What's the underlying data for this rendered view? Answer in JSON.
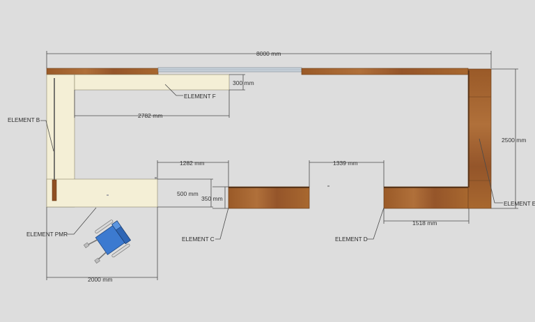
{
  "colors": {
    "background": "#dddddd",
    "wood": "#a4622e",
    "wood_dark": "#7f4a21",
    "cream": "#f4efd6",
    "glass": "#c9d3dc",
    "wheelchair": "#3c7ad0",
    "dimension_line": "#4a4a4a"
  },
  "dimensions": {
    "overall_width": "8000 mm",
    "depth_right": "2500 mm",
    "element_f_depth": "300 mm",
    "element_f_length": "2782 mm",
    "gap_left": "1282 mm",
    "gap_right": "1339 mm",
    "counter_depth": "500 mm",
    "element_c_depth": "350 mm",
    "element_d_length": "1518 mm",
    "pmr_length": "2000 mm"
  },
  "elements": {
    "b": "ELEMENT B",
    "c": "ELEMENT C",
    "d": "ELEMENT D",
    "e": "ELEMENT E",
    "f": "ELEMENT F",
    "pmr": "ELEMENT PMR"
  },
  "icons": {
    "wheelchair": "wheelchair-icon"
  }
}
